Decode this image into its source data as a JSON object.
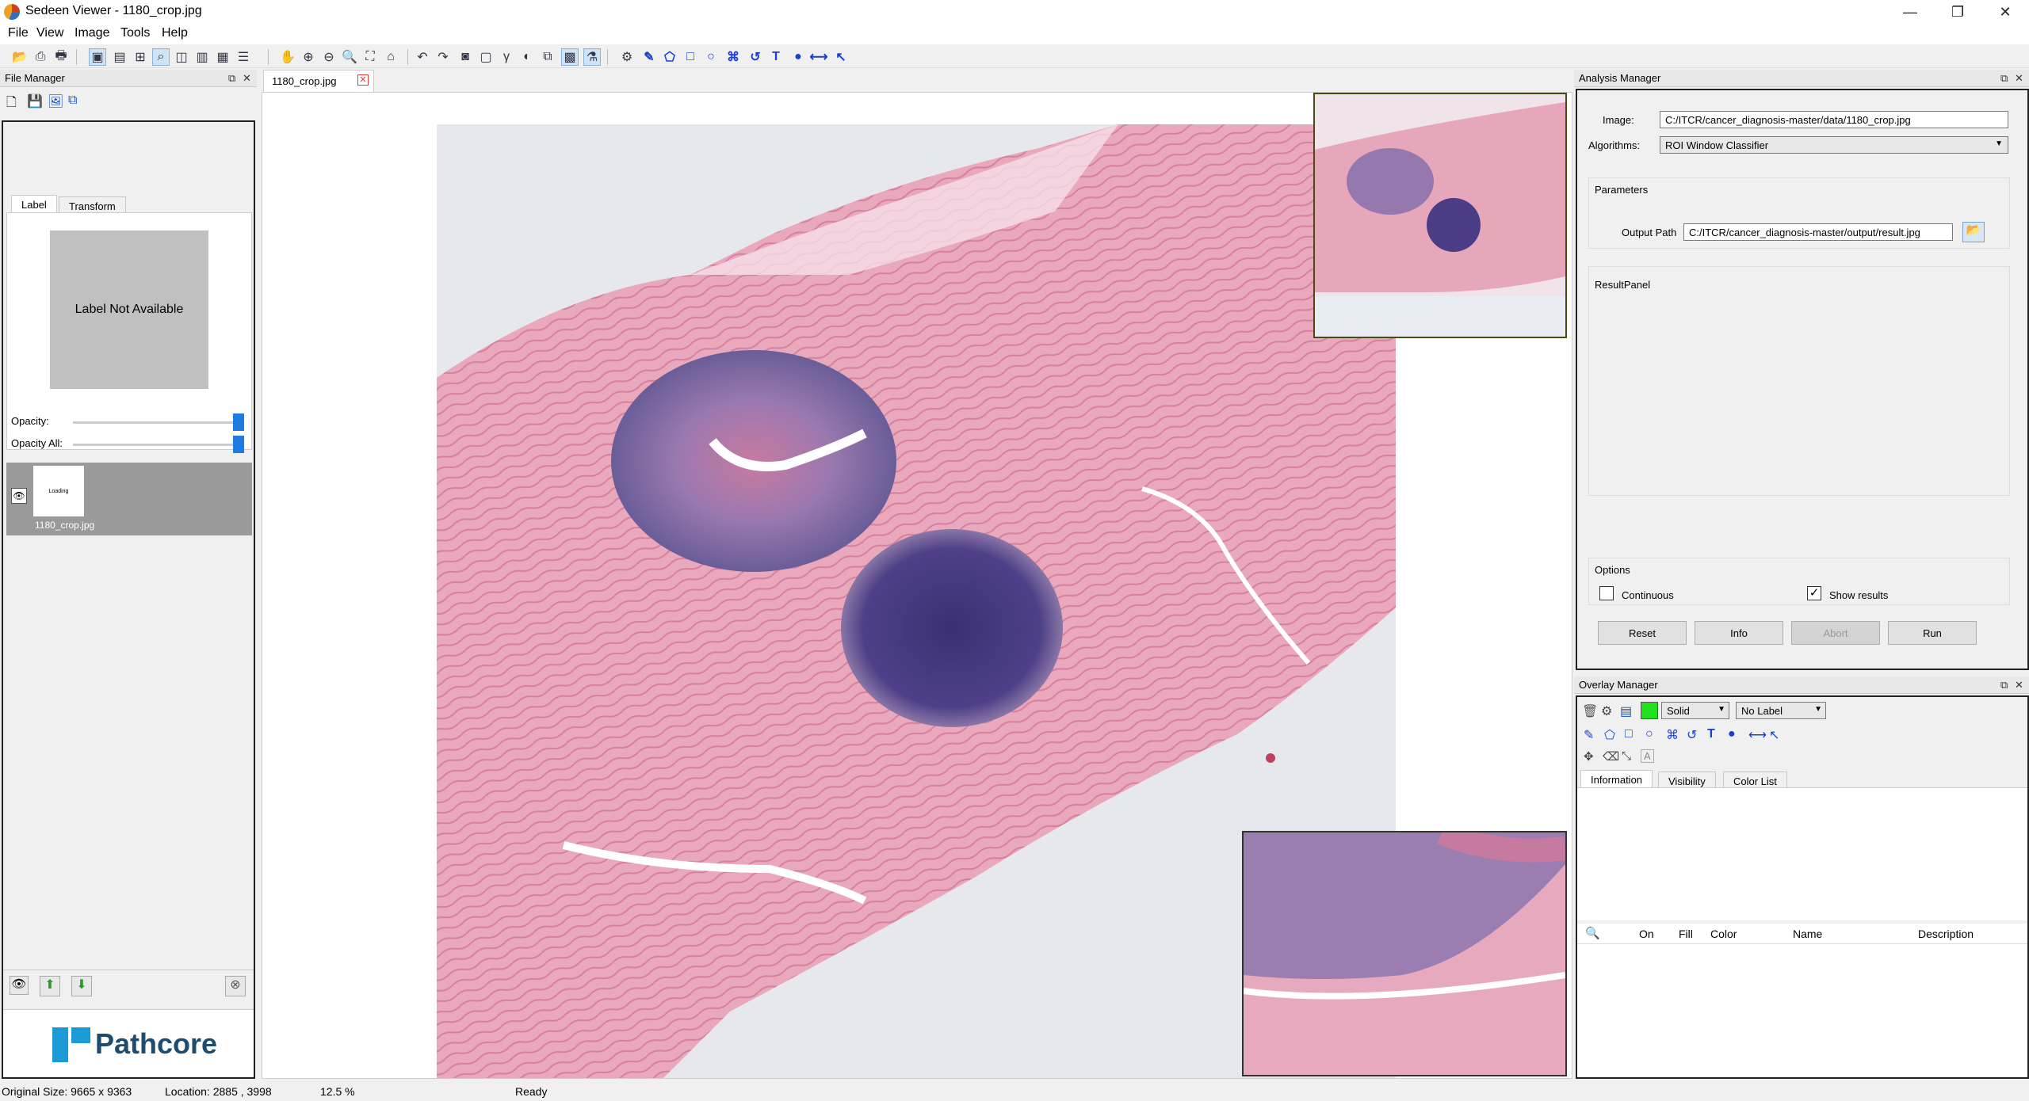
{
  "window": {
    "title": "Sedeen Viewer - 1180_crop.jpg",
    "minimize": "—",
    "restore": "❐",
    "close": "✕"
  },
  "menu": [
    "File",
    "View",
    "Image",
    "Tools",
    "Help"
  ],
  "file_manager": {
    "title": "File Manager",
    "tabs": [
      "Label",
      "Transform"
    ],
    "label_placeholder": "Label Not Available",
    "opacity_label": "Opacity:",
    "opacity_all_label": "Opacity All:",
    "opacity": 1.0,
    "opacity_all": 1.0,
    "file_item": "1180_crop.jpg",
    "thumb_text": "Loading",
    "logo_text": "Pathcore"
  },
  "document_tab": {
    "label": "1180_crop.jpg"
  },
  "analysis_manager": {
    "title": "Analysis Manager",
    "image_label": "Image:",
    "image_value": "C:/ITCR/cancer_diagnosis-master/data/1180_crop.jpg",
    "algorithms_label": "Algorithms:",
    "algorithm_value": "ROI Window Classifier",
    "parameters_title": "Parameters",
    "output_path_label": "Output Path",
    "output_path_value": "C:/ITCR/cancer_diagnosis-master/output/result.jpg",
    "result_panel_title": "ResultPanel",
    "options_title": "Options",
    "continuous_label": "Continuous",
    "continuous_checked": false,
    "show_results_label": "Show results",
    "show_results_checked": true,
    "buttons": {
      "reset": "Reset",
      "info": "Info",
      "abort": "Abort",
      "run": "Run"
    }
  },
  "overlay_manager": {
    "title": "Overlay Manager",
    "fill_style": "Solid",
    "label_select": "No Label",
    "color": "#20e020",
    "tabs": [
      "Information",
      "Visibility",
      "Color List"
    ],
    "columns": [
      "On",
      "Fill",
      "Color",
      "Name",
      "Description"
    ]
  },
  "status": {
    "original_size": "Original Size: 9665 x 9363",
    "location": "Location: 2885 , 3998",
    "zoom": "12.5 %",
    "state": "Ready"
  }
}
